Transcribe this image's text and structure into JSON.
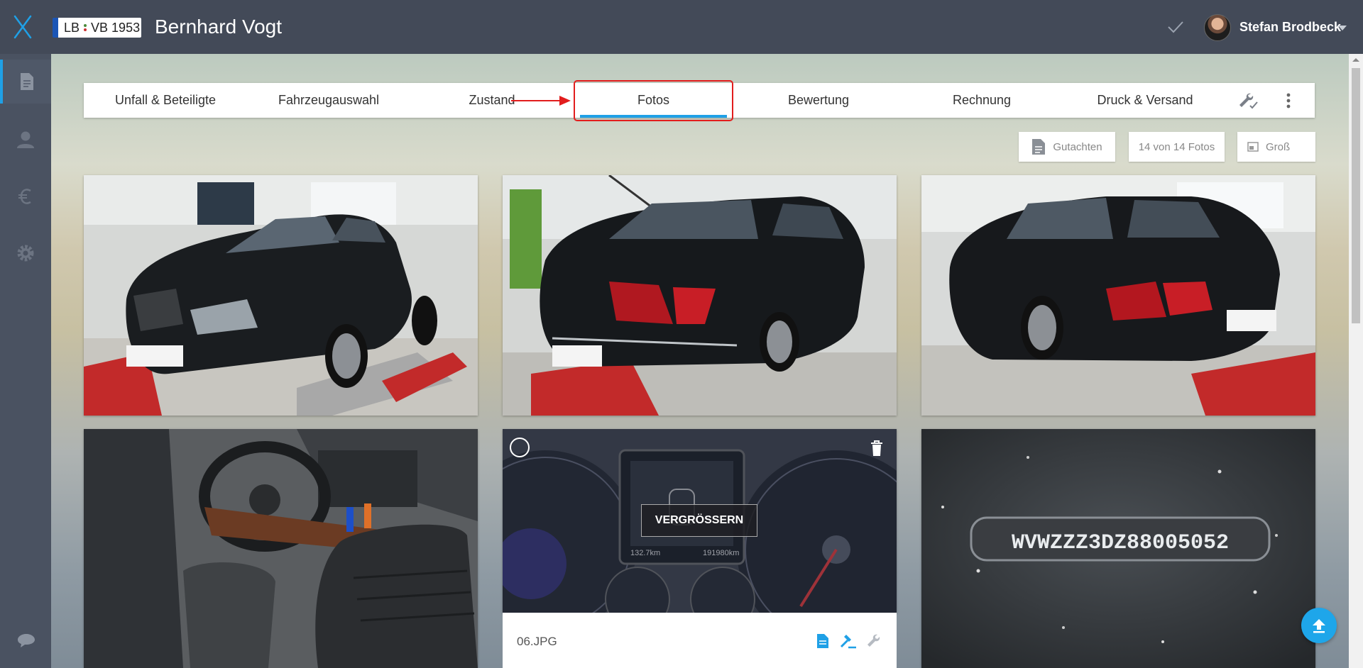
{
  "header": {
    "plate": {
      "left": "LB",
      "right": "VB 1953"
    },
    "owner_name": "Bernhard Vogt",
    "user_name": "Stefan Brodbeck"
  },
  "sidebar": {
    "items": [
      {
        "icon": "document-icon",
        "active": true
      },
      {
        "icon": "person-icon",
        "active": false
      },
      {
        "icon": "euro-icon",
        "active": false
      },
      {
        "icon": "gear-icon",
        "active": false
      }
    ]
  },
  "tabs": [
    {
      "label": "Unfall & Beteiligte"
    },
    {
      "label": "Fahrzeugauswahl"
    },
    {
      "label": "Zustand"
    },
    {
      "label": "Fotos",
      "active": true
    },
    {
      "label": "Bewertung"
    },
    {
      "label": "Rechnung"
    },
    {
      "label": "Druck & Versand"
    }
  ],
  "toolbar": {
    "report_label": "Gutachten",
    "photo_count_label": "14 von 14 Fotos",
    "size_label": "Groß"
  },
  "photos": [
    {
      "content": "car-front-left"
    },
    {
      "content": "car-rear-left"
    },
    {
      "content": "car-rear-right"
    },
    {
      "content": "car-interior"
    },
    {
      "content": "dashboard-cluster",
      "filename": "06.JPG",
      "overlay_button": "VERGRÖSSERN",
      "readouts": [
        "132.7km",
        "191980km"
      ]
    },
    {
      "content": "vin-plate",
      "vin": "WVWZZZ3DZ88005052"
    }
  ],
  "colors": {
    "topbar": "#434a58",
    "sidebar": "#4a5261",
    "accent": "#1fa0e6",
    "highlight": "#e21d1d"
  }
}
